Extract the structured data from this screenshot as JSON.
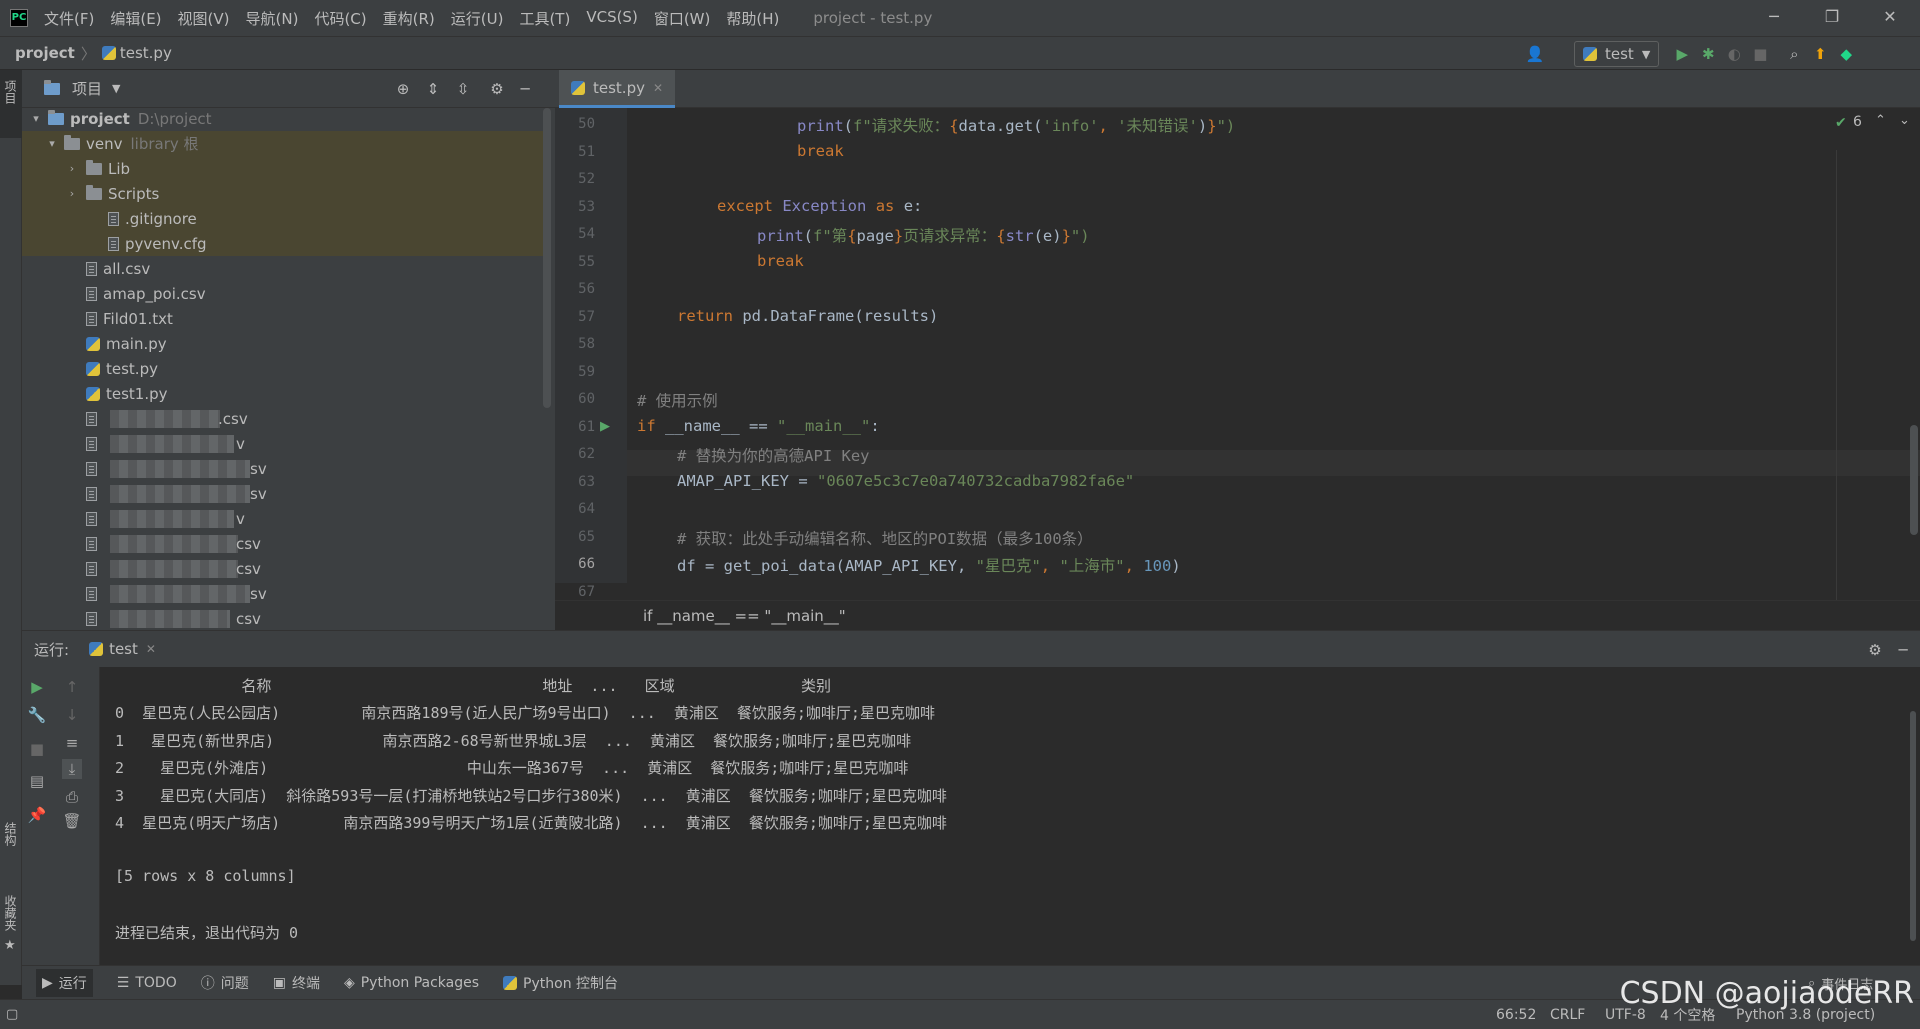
{
  "titlebar": {
    "menu": [
      "文件(F)",
      "编辑(E)",
      "视图(V)",
      "导航(N)",
      "代码(C)",
      "重构(R)",
      "运行(U)",
      "工具(T)",
      "VCS(S)",
      "窗口(W)",
      "帮助(H)"
    ],
    "title": "project - test.py"
  },
  "navbar": {
    "project": "project",
    "file": "test.py",
    "run_config": "test"
  },
  "left_strip": {
    "project_label": "项目",
    "structure_label": "结构",
    "favorites_label": "收藏夹"
  },
  "project_panel": {
    "title": "项目",
    "root": {
      "name": "project",
      "path": "D:\\project"
    },
    "venv": {
      "name": "venv",
      "meta": "library 根"
    },
    "venv_children": [
      "Lib",
      "Scripts"
    ],
    "venv_files": [
      ".gitignore",
      "pyvenv.cfg"
    ],
    "files": [
      "all.csv",
      "amap_poi.csv",
      "Fild01.txt",
      "main.py",
      "test.py",
      "test1.py"
    ],
    "blurred_suffixes": [
      ".csv",
      "v",
      "sv",
      "sv",
      "v",
      "csv",
      "csv",
      "sv",
      "csv"
    ]
  },
  "editor": {
    "tab": "test.py",
    "inspection_count": "6",
    "line_numbers": [
      "50",
      "51",
      "52",
      "53",
      "54",
      "55",
      "56",
      "57",
      "58",
      "59",
      "60",
      "61",
      "62",
      "63",
      "64",
      "65",
      "66",
      "67"
    ],
    "current_line": "66",
    "breadcrumb": "if __name__ == \"__main__\"",
    "code": {
      "l50": {
        "fn": "print",
        "open": "(",
        "f": "f\"请求失败：",
        "b1": "{",
        "expr": "data.get(",
        "s1": "'info'",
        ", ": ", ",
        "s2": "'未知错误'",
        ")": ")",
        "b2": "}",
        "end": "\")"
      },
      "l51": "break",
      "l53": {
        "kw": "except",
        "cls": "Exception",
        "as": "as",
        "rest": "e:"
      },
      "l54": {
        "fn": "print",
        "p1": "(",
        "f1": "f\"第",
        "b1": "{",
        "var": "page",
        "b2": "}",
        "f2": "页请求异常：",
        "b3": "{",
        "fn2": "str",
        "arg": "(e)",
        "b4": "}",
        "end": "\")"
      },
      "l55": "break",
      "l57": {
        "kw": "return",
        "rest": "pd.DataFrame(results)"
      },
      "l60": "# 使用示例",
      "l61": {
        "kw": "if",
        "rest": "__name__ == ",
        "str": "\"__main__\"",
        "colon": ":"
      },
      "l62": "# 替换为你的高德API Key",
      "l63": {
        "var": "AMAP_API_KEY = ",
        "str": "\"0607e5c3c7e0a740732cadba7982fa6e\""
      },
      "l65": "# 获取：此处手动编辑名称、地区的POI数据（最多100条）",
      "l66": {
        "a": "df = get_poi_data(AMAP_API_KEY, ",
        "s1": "\"星巴克\"",
        ", ": ", ",
        "s2": "\"上海市\"",
        "c": ", ",
        "n": "100",
        "end": ")"
      }
    }
  },
  "run_panel": {
    "label": "运行:",
    "tab": "test",
    "header": "              名称                              地址  ...   区域              类别",
    "rows": [
      "0  星巴克(人民公园店)         南京西路189号(近人民广场9号出口)  ...  黄浦区  餐饮服务;咖啡厅;星巴克咖啡",
      "1   星巴克(新世界店)            南京西路2-68号新世界城L3层  ...  黄浦区  餐饮服务;咖啡厅;星巴克咖啡",
      "2    星巴克(外滩店)                      中山东一路367号  ...  黄浦区  餐饮服务;咖啡厅;星巴克咖啡",
      "3    星巴克(大同店)  斜徐路593号一层(打浦桥地铁站2号口步行380米)  ...  黄浦区  餐饮服务;咖啡厅;星巴克咖啡",
      "4  星巴克(明天广场店)       南京西路399号明天广场1层(近黄陂北路)  ...  黄浦区  餐饮服务;咖啡厅;星巴克咖啡"
    ],
    "summary": "[5 rows x 8 columns]",
    "exit": "进程已结束，退出代码为 0"
  },
  "bottom_tabs": [
    "运行",
    "TODO",
    "问题",
    "终端",
    "Python Packages",
    "Python 控制台"
  ],
  "bottom_right": "事件日志",
  "statusbar": {
    "position": "66:52",
    "line_sep": "CRLF",
    "encoding": "UTF-8",
    "indent": "4 个空格",
    "interpreter": "Python 3.8 (project)"
  },
  "watermark": "CSDN @aojiaodeRR",
  "colors": {
    "bg": "#2b2b2b",
    "panel": "#3c3f41",
    "keyword": "#cc7832",
    "string": "#6a8759",
    "number": "#6897bb",
    "comment": "#808080",
    "run": "#59a869"
  }
}
